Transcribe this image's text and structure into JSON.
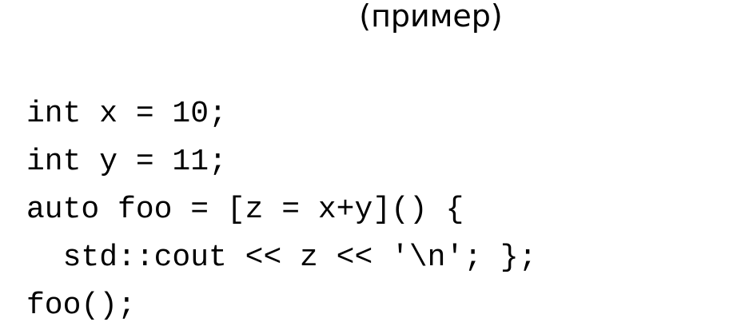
{
  "slide": {
    "title": "(пример)",
    "code_lines": [
      "int x = 10;",
      "int y = 11;",
      "auto foo = [z = x+y]() {",
      "  std::cout << z << '\\n'; };",
      "foo();"
    ]
  }
}
